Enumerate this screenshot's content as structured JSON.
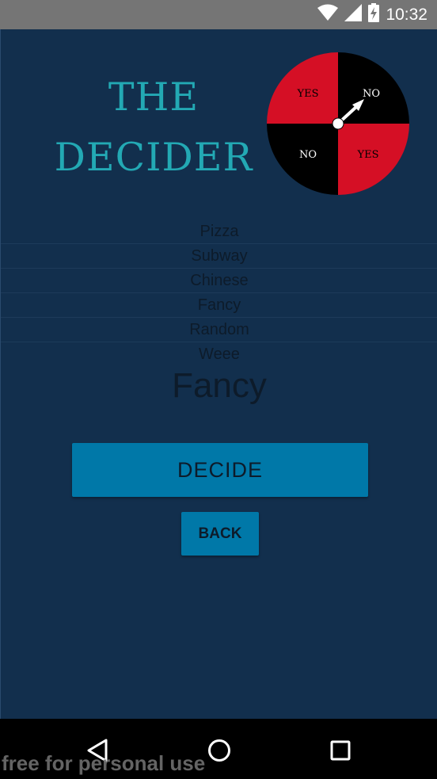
{
  "status_bar": {
    "time": "10:32",
    "icons": [
      "wifi-icon",
      "signal-icon",
      "battery-charging-icon"
    ]
  },
  "app": {
    "title_line1": "THE",
    "title_line2": "DECIDER",
    "wheel": {
      "labels": [
        "YES",
        "NO",
        "NO",
        "YES"
      ],
      "colors": {
        "red": "#d50f25",
        "black": "#000000"
      }
    },
    "options": [
      "Pizza",
      "Subway",
      "Chinese",
      "Fancy",
      "Random",
      "Weee"
    ],
    "selected_result": "Fancy",
    "decide_label": "DECIDE",
    "back_label": "BACK"
  },
  "nav_bar": {
    "buttons": [
      "back-triangle-icon",
      "home-circle-icon",
      "recents-square-icon"
    ]
  },
  "watermark": "free for personal use",
  "colors": {
    "background": "#122f4d",
    "title": "#23a9b4",
    "button": "#0078a8",
    "text_dark": "#0d1b2a"
  }
}
